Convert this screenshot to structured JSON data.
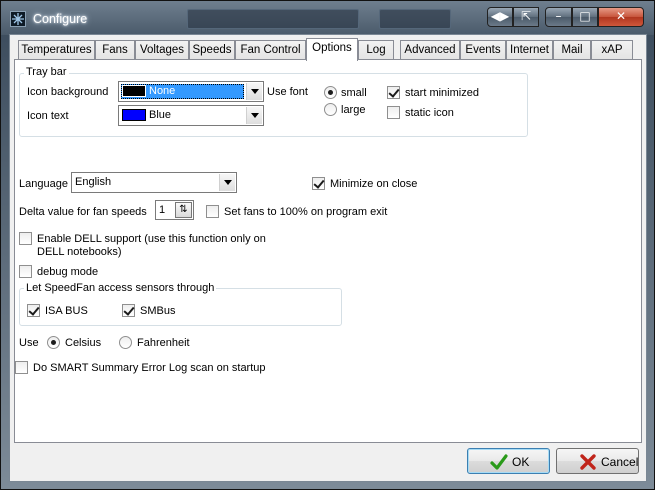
{
  "window": {
    "title": "Configure",
    "controls": {
      "back_forward": "◀▶",
      "snap": "⇱",
      "minimize": "–",
      "maximize": "□",
      "close": "✕"
    }
  },
  "tabs": [
    {
      "label": "Temperatures",
      "active": false
    },
    {
      "label": "Fans",
      "active": false
    },
    {
      "label": "Voltages",
      "active": false
    },
    {
      "label": "Speeds",
      "active": false
    },
    {
      "label": "Fan Control",
      "active": false
    },
    {
      "label": "Options",
      "active": true
    },
    {
      "label": "Log",
      "active": false
    },
    {
      "label": "Advanced",
      "active": false
    },
    {
      "label": "Events",
      "active": false
    },
    {
      "label": "Internet",
      "active": false
    },
    {
      "label": "Mail",
      "active": false
    },
    {
      "label": "xAP",
      "active": false
    }
  ],
  "tray_bar": {
    "title": "Tray bar",
    "icon_background_label": "Icon background",
    "icon_background_value": "None",
    "icon_background_color": "#000000",
    "icon_text_label": "Icon text",
    "icon_text_value": "Blue",
    "icon_text_color": "#0000ff",
    "use_font_label": "Use font",
    "font_small": "small",
    "font_large": "large",
    "font_selected": "small",
    "start_minimized_label": "start minimized",
    "start_minimized": true,
    "static_icon_label": "static icon",
    "static_icon": false
  },
  "language": {
    "label": "Language",
    "value": "English"
  },
  "minimize_on_close": {
    "label": "Minimize on close",
    "checked": true
  },
  "delta": {
    "label": "Delta value for fan speeds",
    "value": "1"
  },
  "fans_100": {
    "label": "Set fans to 100% on program exit",
    "checked": false
  },
  "dell": {
    "label": "Enable DELL support (use this function only on",
    "label2": "DELL notebooks)",
    "checked": false
  },
  "debug": {
    "label": "debug mode",
    "checked": false
  },
  "sensors": {
    "title": "Let SpeedFan access sensors through",
    "isa_bus": {
      "label": "ISA BUS",
      "checked": true
    },
    "smbus": {
      "label": "SMBus",
      "checked": true
    }
  },
  "units": {
    "label": "Use",
    "celsius": "Celsius",
    "fahrenheit": "Fahrenheit",
    "selected": "Celsius"
  },
  "smart": {
    "label": "Do SMART Summary Error Log scan on startup",
    "checked": false
  },
  "footer": {
    "ok": "OK",
    "cancel": "Cancel"
  },
  "colors": {
    "ok_check": "#2a9a1a",
    "cancel_x": "#c0241a",
    "selection": "#3399ff"
  }
}
